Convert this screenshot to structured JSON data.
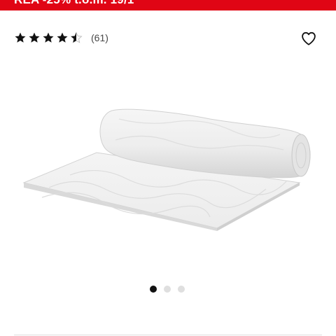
{
  "promo": {
    "text": "REA -25% t.o.m. 19/1"
  },
  "rating": {
    "value": 4.5,
    "max": 5,
    "count_label": "(61)"
  },
  "icons": {
    "star": "star-icon",
    "wishlist": "heart-icon"
  },
  "carousel": {
    "total": 3,
    "active": 0
  },
  "colors": {
    "brand_red": "#e00515",
    "star": "#111111",
    "dot_active": "#111111",
    "dot_inactive": "#dfdfdf"
  }
}
